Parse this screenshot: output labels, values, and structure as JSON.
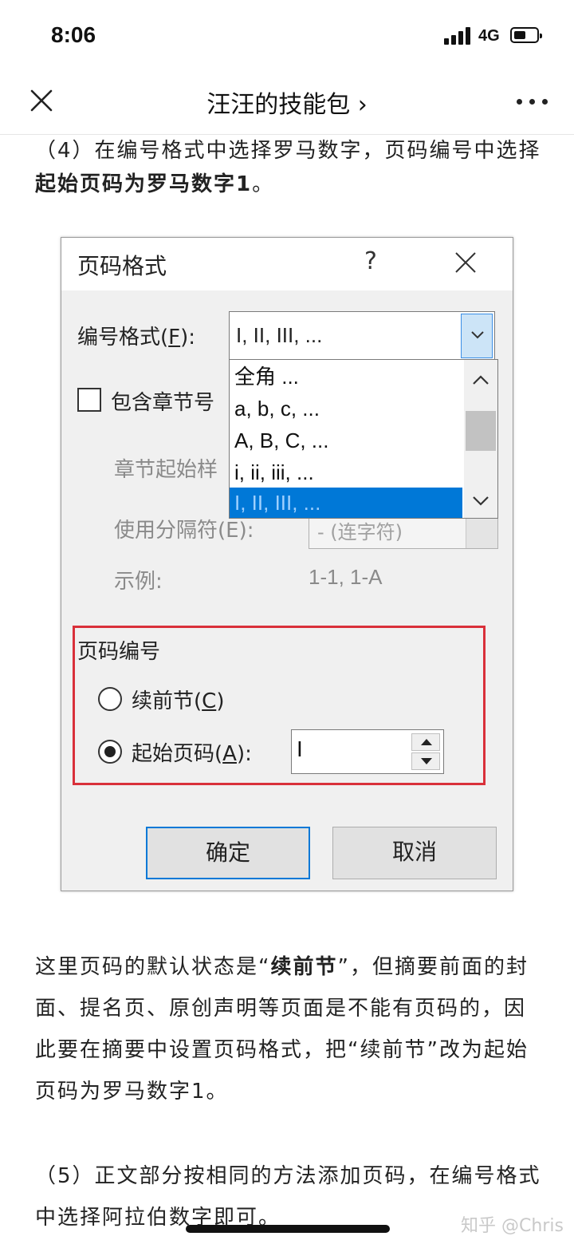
{
  "status_bar": {
    "time": "8:06",
    "network": "4G"
  },
  "nav": {
    "title": "汪汪的技能包 ›"
  },
  "article": {
    "p1": {
      "prefix": "（4）在编号格式中选择罗马数字，页码编号中选择",
      "bold": "起始页码为罗马数字1",
      "suffix": "。"
    },
    "p2": {
      "prefix": "这里页码的默认状态是“",
      "bold": "续前节",
      "suffix": "”，但摘要前面的封面、提名页、原创声明等页面是不能有页码的，因此要在摘要中设置页码格式，把“续前节”改为起始页码为罗马数字1。"
    },
    "p3": "（5）正文部分按相同的方法添加页码，在编号格式中选择阿拉伯数字即可。"
  },
  "dialog": {
    "title": "页码格式",
    "help": "?",
    "number_format_label": "编号格式(",
    "number_format_key": "F",
    "number_format_suffix": "):",
    "number_format_value": "I, II, III, ...",
    "dropdown_options": [
      "全角 ...",
      "a, b, c, ...",
      "A, B, C, ...",
      "i, ii, iii, ...",
      "I, II, III, ..."
    ],
    "include_chapter_label": "包含章节号",
    "chapter_start_label": "章节起始样",
    "separator_label": "使用分隔符(E):",
    "separator_value": "-  (连字符)",
    "example_label": "示例:",
    "example_value": "1-1, 1-A",
    "page_numbering_label": "页码编号",
    "continue_label": "续前节(",
    "continue_key": "C",
    "continue_suffix": ")",
    "start_at_label": "起始页码(",
    "start_at_key": "A",
    "start_at_suffix": "):",
    "start_at_value": "I",
    "ok_label": "确定",
    "cancel_label": "取消"
  },
  "watermark": "知乎 @Chris"
}
